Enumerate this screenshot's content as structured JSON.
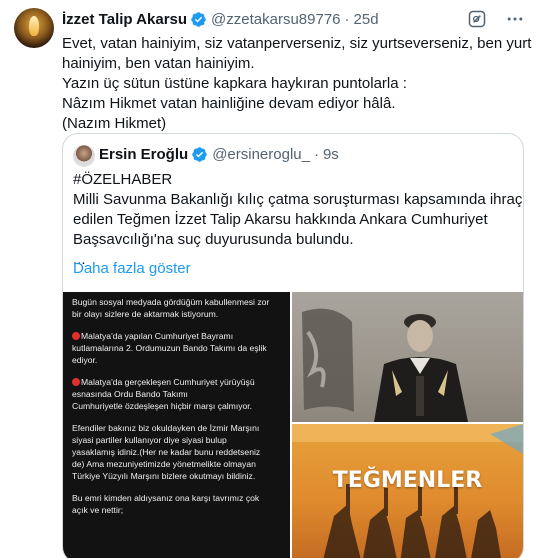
{
  "tweet": {
    "author_name": "İzzet Talip Akarsu",
    "handle": "@zzetakarsu89776",
    "separator": "·",
    "time": "25d",
    "lines": [
      "Evet, vatan hainiyim, siz vatanperverseniz, siz yurtseverseniz, ben yurt",
      "hainiyim, ben vatan hainiyim.",
      "Yazın üç sütun üstüne kapkara haykıran puntolarla :",
      "Nâzım Hikmet vatan hainliğine devam ediyor hâlâ.",
      "(Nazım Hikmet)"
    ],
    "header_icons": [
      "grok-icon",
      "more-options-icon"
    ]
  },
  "quote": {
    "author_name": "Ersin Eroğlu",
    "handle": "@ersineroglu_",
    "separator": "·",
    "time": "9s",
    "lines": [
      "#ÖZELHABER",
      "Milli Savunma Bakanlığı kılıç çatma soruşturması kapsamında ihraç",
      "edilen Teğmen İzzet Talip Akarsu hakkında Ankara Cumhuriyet",
      "Başsavcılığı'na suç duyurusunda bulundu.",
      "..."
    ],
    "show_more": "Daha fazla göster",
    "media": {
      "dark_panel_lines": [
        "Bugün sosyal medyada gördüğüm kabullenmesi zor",
        "bir olayı sizlere de aktarmak istiyorum.",
        "Malatya'da yapılan Cumhuriyet Bayramı",
        "kutlamalarına 2. Ordumuzun Bando Takımı da eşlik",
        "ediyor.",
        "Malatya'da gerçekleşen Cumhuriyet yürüyüşü",
        "esnasında Ordu Bando Takımı",
        "Cumhuriyetle özdeşleşen hiçbir marşı çalmıyor.",
        "Efendiler bakınız biz okuldayken de İzmir Marşını",
        "siyasi partiler kullanıyor diye siyasi bulup",
        "yasaklamış idiniz.(Her ne kadar bunu reddetseniz",
        "de) Ama mezuniyetimizde yönetmelikte olmayan",
        "Türkiye Yüzyılı Marşını bizlere okutmayı bildiniz.",
        "Bu emri kimden aldıysanız ona karşı tavrımız çok",
        "açık ve nettir;"
      ],
      "book_title": "TEĞMENLER"
    }
  },
  "colors": {
    "verified_blue": "#1d9bf0",
    "link_blue": "#1d9bf0",
    "muted_gray": "#536471",
    "border": "#cfd9de",
    "alert_red": "#e0302a"
  }
}
